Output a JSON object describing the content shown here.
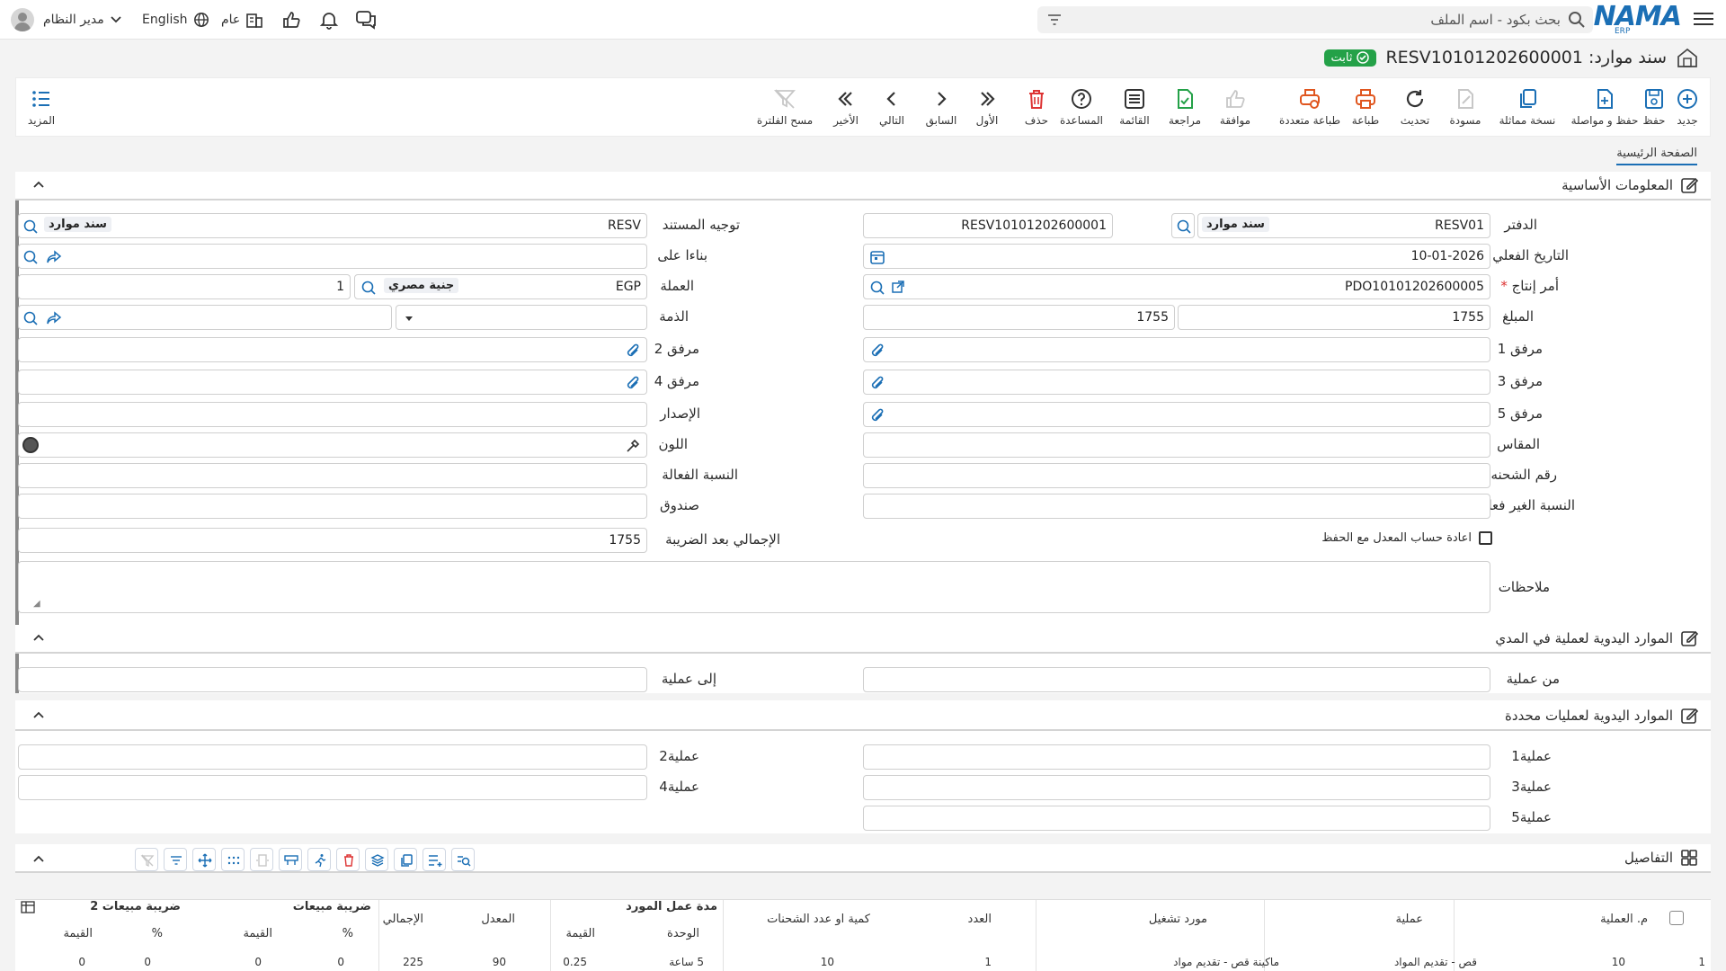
{
  "topbar": {
    "search_placeholder": "بحث بكود - اسم الملف",
    "logo": "NAMA",
    "logo_sub": "ERP",
    "user": "مدير النظام",
    "language": "English",
    "scope": "عام"
  },
  "page": {
    "title": "سند موارد: RESV10101202600001",
    "status": "ثابت"
  },
  "toolbar": {
    "new": "جديد",
    "save": "حفظ",
    "save_continue": "حفظ و مواصلة",
    "copy": "نسخة مماثلة",
    "draft": "مسودة",
    "refresh": "تحديث",
    "print": "طباعة",
    "multi_print": "طباعة متعددة",
    "approve": "موافقة",
    "review": "مراجعة",
    "list": "القائمة",
    "help": "المساعدة",
    "delete": "حذف",
    "first": "الأول",
    "previous": "السابق",
    "next": "التالي",
    "last": "الأخير",
    "clear_filter": "مسح الفلترة",
    "more": "المزيد"
  },
  "tabs": [
    "الصفحة الرئيسية"
  ],
  "sections": {
    "basic": "المعلومات الأساسية",
    "range": "الموارد اليدوية لعملية في المدي",
    "specific": "الموارد اليدوية لعمليات محددة",
    "details": "التفاصيل"
  },
  "form": {
    "book_label": "الدفتر",
    "book_code": "RESV01",
    "book_name": "سند موارد",
    "doc_no": "RESV10101202600001",
    "direction_label": "توجيه المستند",
    "direction_code": "RESV",
    "direction_name": "سند موارد",
    "date_label": "التاريخ الفعلي",
    "date": "10-01-2026",
    "based_on_label": "بناءا على",
    "order_label": "أمر إنتاج",
    "order_value": "PDO10101202600005",
    "currency_label": "العملة",
    "currency_code": "EGP",
    "currency_name": "جنية مصري",
    "currency_rate": "1",
    "amount_label": "المبلغ",
    "amount_1": "1755",
    "amount_2": "1755",
    "debt_label": "الذمة",
    "att1": "مرفق 1",
    "att2": "مرفق 2",
    "att3": "مرفق 3",
    "att4": "مرفق 4",
    "att5": "مرفق 5",
    "version_label": "الإصدار",
    "size_label": "المقاس",
    "color_label": "اللون",
    "shipment_label": "رقم الشحنه",
    "effective_label": "النسبة الفعالة",
    "ineffective_label": "النسبة الغير فعالة",
    "box_label": "صندوق",
    "total_label": "الإجمالي بعد الضريبة",
    "total_value": "1755",
    "recalc_label": "اعادة حساب المعدل مع الحفظ",
    "notes_label": "ملاحظات",
    "from_op": "من عملية",
    "to_op": "إلى عملية",
    "op1": "عملية1",
    "op2": "عملية2",
    "op3": "عملية3",
    "op4": "عملية4",
    "op5": "عملية5"
  },
  "grid": {
    "headers": {
      "op_no": "م. العملية",
      "op": "عملية",
      "resource": "مورد تشغيل",
      "count": "العدد",
      "qty": "كمية او عدد الشحنات",
      "duration": "مدة عمل المورد",
      "unit": "الوحدة",
      "value": "القيمة",
      "rate": "المعدل",
      "total": "الإجمالي",
      "tax": "ضريبة مبيعات",
      "tax_pct": "%",
      "tax_val": "القيمة",
      "tax2": "ضريبة مبيعات 2",
      "tax2_pct": "%",
      "tax2_val": "القيمة"
    },
    "rows": [
      {
        "n": "1",
        "op_no": "10",
        "op": "قص - تقديم المواد",
        "resource": "ماكينة قص - تقديم مواد",
        "count": "1",
        "qty": "10",
        "unit": "5 ساعة",
        "value": "0.25",
        "rate": "90",
        "total": "225",
        "tax_pct": "0",
        "tax_val": "0",
        "tax2_pct": "0",
        "tax2_val": "0"
      }
    ]
  }
}
